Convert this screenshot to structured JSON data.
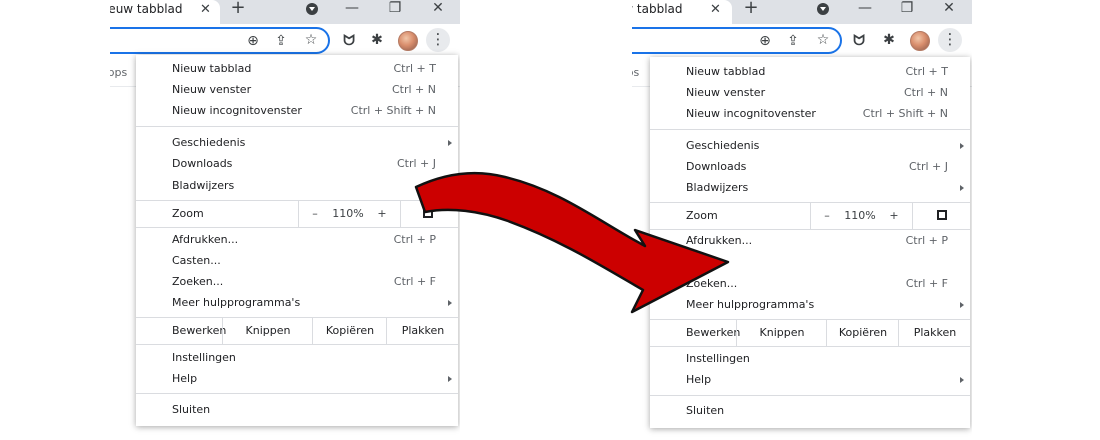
{
  "browser": {
    "tab_title": "Nieuw tabblad",
    "bookmarks_apps_label": "Apps",
    "icons": {
      "tab_close": "close-icon",
      "new_tab": "plus-icon",
      "tab_search": "dropdown-circle-icon",
      "minimize": "minimize-icon",
      "restore": "restore-icon",
      "close_window": "close-icon",
      "zoom": "zoom-icon",
      "share": "share-icon",
      "star": "star-icon",
      "extension_1": "feather-icon",
      "extensions": "puzzle-icon",
      "profile": "avatar",
      "menu": "kebab-icon"
    }
  },
  "menu": {
    "group1": [
      {
        "label": "Nieuw tabblad",
        "shortcut": "Ctrl + T"
      },
      {
        "label": "Nieuw venster",
        "shortcut": "Ctrl + N"
      },
      {
        "label": "Nieuw incognitovenster",
        "shortcut": "Ctrl + Shift + N"
      }
    ],
    "group2": [
      {
        "label": "Geschiedenis",
        "shortcut": "",
        "submenu": true
      },
      {
        "label": "Downloads",
        "shortcut": "Ctrl + J",
        "submenu": false
      },
      {
        "label": "Bladwijzers",
        "shortcut": "",
        "submenu": true
      }
    ],
    "zoom": {
      "label": "Zoom",
      "minus": "–",
      "value": "110%",
      "plus": "+"
    },
    "group3": [
      {
        "label": "Afdrukken...",
        "shortcut": "Ctrl + P",
        "submenu": false
      },
      {
        "label": "Casten...",
        "shortcut": "",
        "submenu": false
      },
      {
        "label": "Zoeken...",
        "shortcut": "Ctrl + F",
        "submenu": false
      },
      {
        "label": "Meer hulpprogramma's",
        "shortcut": "",
        "submenu": true
      }
    ],
    "edit": {
      "label": "Bewerken",
      "cut": "Knippen",
      "copy": "Kopiëren",
      "paste": "Plakken"
    },
    "group4": [
      {
        "label": "Instellingen",
        "submenu": false
      },
      {
        "label": "Help",
        "submenu": true
      }
    ],
    "exit": {
      "label": "Sluiten"
    }
  },
  "annotation": {
    "arrow_color": "#cc0000",
    "arrow_outline": "#111111"
  },
  "colors": {
    "accent": "#1a73e8",
    "tabstrip": "#dee1e6"
  }
}
